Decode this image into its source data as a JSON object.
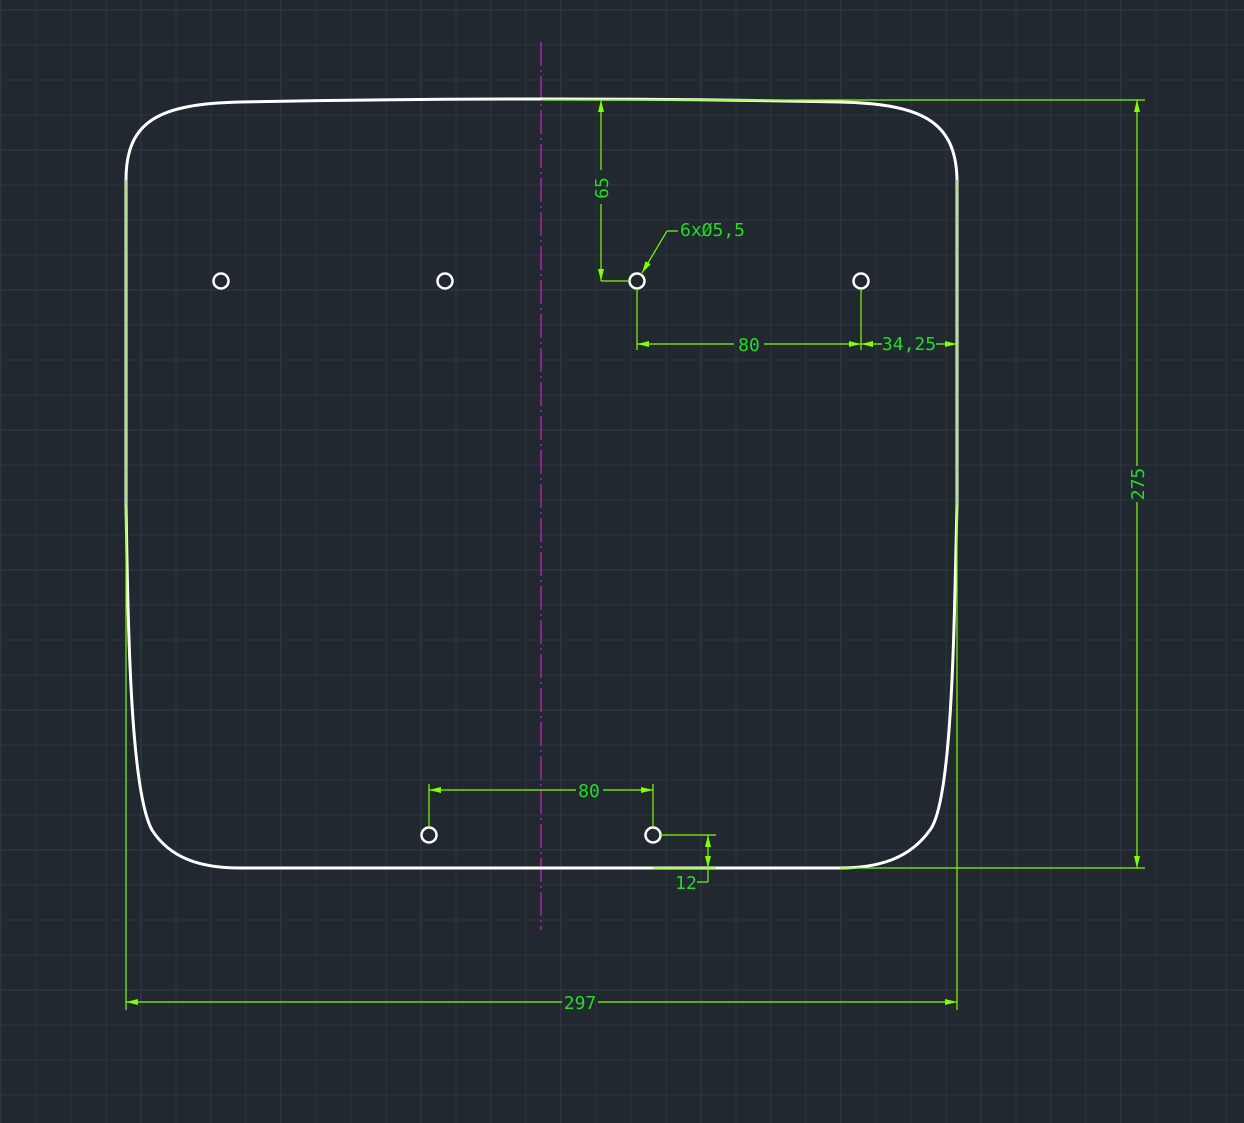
{
  "drawing": {
    "colors": {
      "background": "#212830",
      "outline": "#ffffff",
      "dimension": "#7fff00",
      "dimension_text": "#22dd22",
      "center_line": "#d020d0"
    },
    "dimensions": {
      "overall_width": "297",
      "overall_height": "275",
      "hole_from_top": "65",
      "hole_spec": "6xØ5,5",
      "top_hole_spacing": "80",
      "hole_to_edge": "34,25",
      "bottom_hole_spacing": "80",
      "bottom_hole_offset": "12"
    },
    "holes": {
      "count": 6,
      "diameter": 5.5
    }
  }
}
